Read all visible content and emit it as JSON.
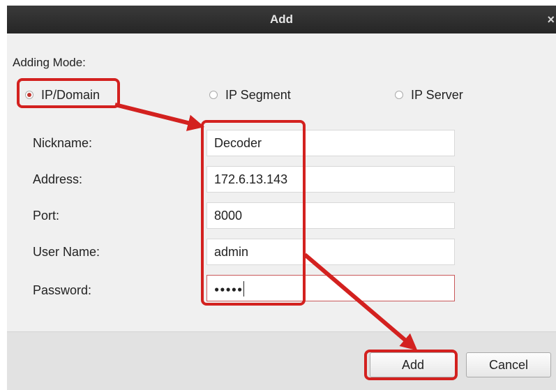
{
  "dialog": {
    "title": "Add",
    "close_glyph": "×"
  },
  "adding_mode": {
    "label": "Adding Mode:",
    "options": [
      {
        "label": "IP/Domain",
        "selected": true
      },
      {
        "label": "IP Segment",
        "selected": false
      },
      {
        "label": "IP Server",
        "selected": false
      }
    ]
  },
  "form": {
    "nickname": {
      "label": "Nickname:",
      "value": "Decoder"
    },
    "address": {
      "label": "Address:",
      "value": "172.6.13.143"
    },
    "port": {
      "label": "Port:",
      "value": "8000"
    },
    "username": {
      "label": "User Name:",
      "value": "admin"
    },
    "password": {
      "label": "Password:",
      "value": "●●●●●"
    }
  },
  "buttons": {
    "add_label": "Add",
    "cancel_label": "Cancel"
  },
  "colors": {
    "highlight": "#d3211f",
    "titlebar": "#2e2e2e",
    "dialog_bg": "#f0f0f0"
  },
  "icons": {
    "close": "close-icon",
    "radio": "radio-button-icon"
  }
}
